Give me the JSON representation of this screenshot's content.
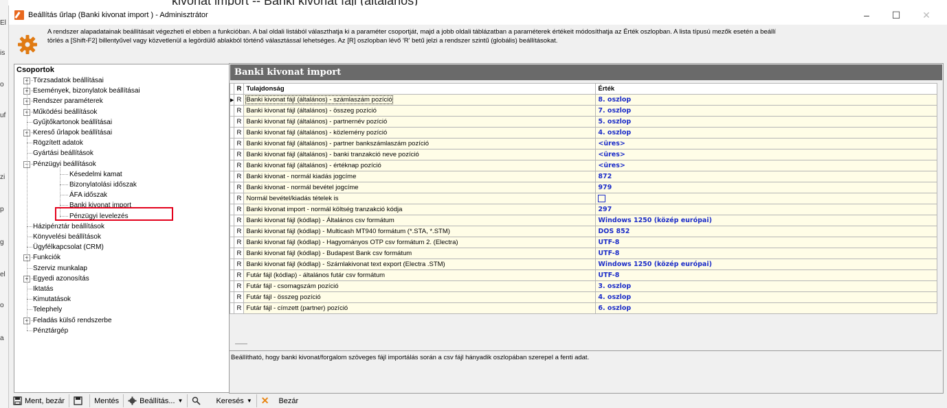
{
  "background": {
    "top_text": "kivonat import -- Banki kivonat fájl (általános)",
    "left_fragments": [
      "El",
      "is",
      "o",
      "uf",
      "zi",
      "p",
      "g",
      "el",
      "o",
      "a"
    ]
  },
  "window": {
    "title": "Beállítás űrlap (Banki kivonat import ) - Adminisztrátor",
    "minimize": "–",
    "maximize": "☐",
    "close": "✕"
  },
  "info": {
    "line1": "A rendszer alapadatainak beállításait végezheti el ebben a funkcióban. A bal oldali listából választhatja ki a paraméter csoportját, majd a jobb oldali táblázatban a paraméterek értékeit módosíthatja az Érték oszlopban. A lista típusú mezők esetén a beállí",
    "line2": "törlés a [Shift-F2] billentyűvel vagy közvetlenül a legördülő ablakból történő választással lehetséges. Az [R] oszlopban lévő 'R' betű jelzi a rendszer szintű (globális) beállításokat."
  },
  "tree": {
    "header": "Csoportok",
    "items": [
      {
        "label": "Törzsadatok beállításai",
        "expander": "+"
      },
      {
        "label": "Események, bizonylatok beállításai",
        "expander": "+"
      },
      {
        "label": "Rendszer paraméterek",
        "expander": "+"
      },
      {
        "label": "Működési beállítások",
        "expander": "+"
      },
      {
        "label": "Gyűjtőkartonok beállításai",
        "expander": ""
      },
      {
        "label": "Kereső űrlapok beállításai",
        "expander": "+"
      },
      {
        "label": "Rögzített adatok",
        "expander": ""
      },
      {
        "label": "Gyártási beállítások",
        "expander": ""
      },
      {
        "label": "Pénzügyi beállítások",
        "expander": "−"
      },
      {
        "label": "Késedelmi kamat",
        "expander": ""
      },
      {
        "label": "Bizonylatolási időszak",
        "expander": ""
      },
      {
        "label": "ÁFA időszak",
        "expander": ""
      },
      {
        "label": "Banki kivonat import",
        "expander": ""
      },
      {
        "label": "Pénzügyi levelezés",
        "expander": ""
      },
      {
        "label": "Házipénztár beállítások",
        "expander": ""
      },
      {
        "label": "Könyvelési beállítások",
        "expander": ""
      },
      {
        "label": "Ügyfélkapcsolat (CRM)",
        "expander": ""
      },
      {
        "label": "Funkciók",
        "expander": "+"
      },
      {
        "label": "Szerviz munkalap",
        "expander": ""
      },
      {
        "label": "Egyedi azonosítás",
        "expander": "+"
      },
      {
        "label": "Iktatás",
        "expander": ""
      },
      {
        "label": "Kimutatások",
        "expander": ""
      },
      {
        "label": "Telephely",
        "expander": ""
      },
      {
        "label": "Feladás külső rendszerbe",
        "expander": "+"
      },
      {
        "label": "Pénztárgép",
        "expander": ""
      }
    ]
  },
  "section_title": "Banki kivonat import",
  "grid": {
    "col_r": "R",
    "col_property": "Tulajdonság",
    "col_value": "Érték",
    "rows": [
      {
        "r": "R",
        "property": "Banki kivonat fájl (általános) - számlaszám pozíció",
        "value": "8. oszlop"
      },
      {
        "r": "R",
        "property": "Banki kivonat fájl (általános) - összeg pozíció",
        "value": "7. oszlop"
      },
      {
        "r": "R",
        "property": "Banki kivonat fájl (általános) - partnernév pozíció",
        "value": "5. oszlop"
      },
      {
        "r": "R",
        "property": "Banki kivonat fájl (általános) - közlemény pozíció",
        "value": "4. oszlop"
      },
      {
        "r": "R",
        "property": "Banki kivonat fájl (általános) - partner bankszámlaszám pozíció",
        "value": "<üres>"
      },
      {
        "r": "R",
        "property": "Banki kivonat fájl (általános) - banki tranzakció neve pozíció",
        "value": "<üres>"
      },
      {
        "r": "R",
        "property": "Banki kivonat fájl (általános) - értéknap pozíció",
        "value": "<üres>"
      },
      {
        "r": "R",
        "property": "Banki kivonat - normál kiadás jogcíme",
        "value": "872"
      },
      {
        "r": "R",
        "property": "Banki kivonat - normál bevétel jogcíme",
        "value": "979"
      },
      {
        "r": "R",
        "property": "Normál bevétel/kiadás tételek is",
        "value": ""
      },
      {
        "r": "R",
        "property": "Banki kivonat import - normál költség tranzakció kódja",
        "value": "297"
      },
      {
        "r": "R",
        "property": "Banki kivonat fájl (kódlap) - Általános csv formátum",
        "value": "Windows 1250 (közép európai)"
      },
      {
        "r": "R",
        "property": "Banki kivonat fájl (kódlap) - Multicash MT940 formátum (*.STA, *.STM)",
        "value": "DOS 852"
      },
      {
        "r": "R",
        "property": "Banki kivonat fájl (kódlap) - Hagyományos OTP csv formátum 2. (Electra)",
        "value": "UTF-8"
      },
      {
        "r": "R",
        "property": "Banki kivonat fájl (kódlap) - Budapest Bank csv formátum",
        "value": "UTF-8"
      },
      {
        "r": "R",
        "property": "Banki kivonat fájl (kódlap) - Számlakivonat text export (Electra .STM)",
        "value": "Windows 1250 (közép európai)"
      },
      {
        "r": "R",
        "property": "Futár fájl  (kódlap) - általános futár csv formátum",
        "value": "UTF-8"
      },
      {
        "r": "R",
        "property": "Futár fájl - csomagszám pozíció",
        "value": "3. oszlop"
      },
      {
        "r": "R",
        "property": "Futár fájl - összeg pozíció",
        "value": "4. oszlop"
      },
      {
        "r": "R",
        "property": "Futár fájl - címzett (partner) pozíció",
        "value": "6. oszlop"
      }
    ]
  },
  "description": "Beállítható, hogy banki kivonat/forgalom szöveges fájl importálás során a csv fájl hányadik oszlopában szerepel a fenti adat.",
  "toolbar": {
    "save_close": "Ment, bezár",
    "save": "Mentés",
    "settings": "Beállítás...",
    "search": "Keresés",
    "close": "Bezár"
  },
  "colors": {
    "accent_value": "#1a2bc8",
    "row_bg": "#fffde7",
    "highlight": "#e3001b",
    "section_bg": "#6a6a6a"
  }
}
